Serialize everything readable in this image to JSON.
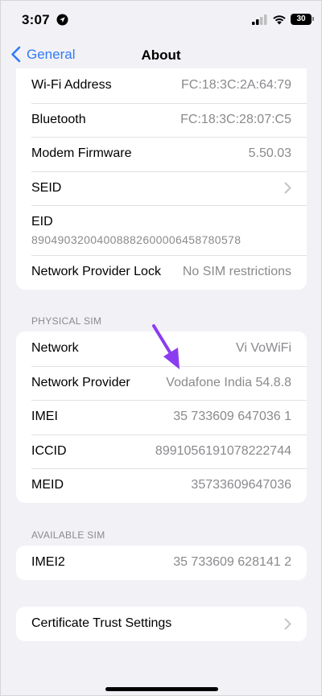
{
  "status_bar": {
    "time": "3:07",
    "battery": "30"
  },
  "nav": {
    "back_label": "General",
    "title": "About"
  },
  "groups": {
    "device": {
      "wifi_address": {
        "label": "Wi-Fi Address",
        "value": "FC:18:3C:2A:64:79"
      },
      "bluetooth": {
        "label": "Bluetooth",
        "value": "FC:18:3C:28:07:C5"
      },
      "modem_firmware": {
        "label": "Modem Firmware",
        "value": "5.50.03"
      },
      "seid": {
        "label": "SEID"
      },
      "eid": {
        "label": "EID",
        "value": "89049032004008882600006458780578"
      },
      "network_provider_lock": {
        "label": "Network Provider Lock",
        "value": "No SIM restrictions"
      }
    },
    "physical_sim": {
      "header": "PHYSICAL SIM",
      "network": {
        "label": "Network",
        "value": "Vi VoWiFi"
      },
      "network_provider": {
        "label": "Network Provider",
        "value": "Vodafone India 54.8.8"
      },
      "imei": {
        "label": "IMEI",
        "value": "35 733609 647036 1"
      },
      "iccid": {
        "label": "ICCID",
        "value": "8991056191078222744"
      },
      "meid": {
        "label": "MEID",
        "value": "35733609647036"
      }
    },
    "available_sim": {
      "header": "AVAILABLE SIM",
      "imei2": {
        "label": "IMEI2",
        "value": "35 733609 628141 2"
      }
    },
    "certificates": {
      "certificate_trust_settings": {
        "label": "Certificate Trust Settings"
      }
    }
  },
  "colors": {
    "accent": "#2f7cf6",
    "annotation_arrow": "#8b3cf0",
    "background": "#f2f1f6",
    "secondary_text": "#8a8a8e"
  },
  "icons": [
    "location-icon",
    "signal-icon",
    "wifi-icon",
    "battery-icon",
    "back-chevron-icon",
    "chevron-right-icon",
    "annotation-arrow"
  ]
}
